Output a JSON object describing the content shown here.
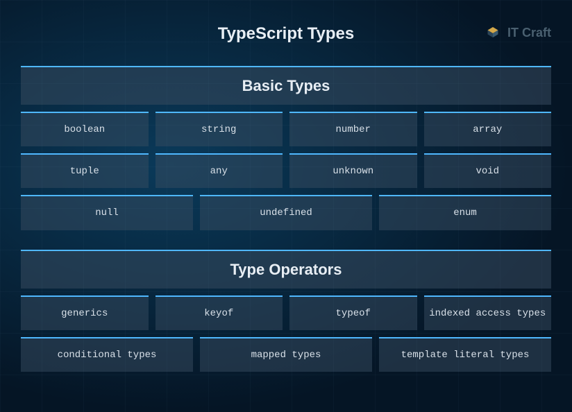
{
  "title": "TypeScript Types",
  "logo": {
    "text": "IT Craft"
  },
  "sections": [
    {
      "header": "Basic Types",
      "rows": [
        [
          "boolean",
          "string",
          "number",
          "array"
        ],
        [
          "tuple",
          "any",
          "unknown",
          "void"
        ],
        [
          "null",
          "undefined",
          "enum"
        ]
      ]
    },
    {
      "header": "Type Operators",
      "rows": [
        [
          "generics",
          "keyof",
          "typeof",
          "indexed access types"
        ],
        [
          "conditional types",
          "mapped types",
          "template literal types"
        ]
      ]
    }
  ]
}
